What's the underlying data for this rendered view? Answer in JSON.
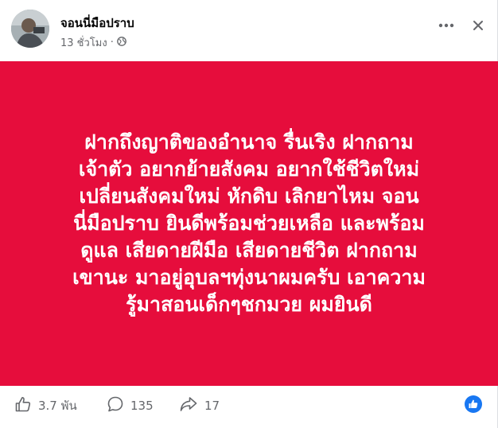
{
  "post": {
    "author": "จอนนี่มือปราบ",
    "time": "13 ชั่วโมง",
    "separator": "·",
    "privacy_icon": "globe-icon",
    "text": "ฝากถึงญาติของอำนาจ รื่นเริง ฝากถาม\nเจ้าตัว อยากย้ายสังคม อยากใช้ชีวิตใหม่\nเปลี่ยนสังคมใหม่ หักดิบ เลิกยาไหม จอน\nนี่มือปราบ ยินดีพร้อมช่วยเหลือ และพร้อม\nดูแล เสียดายฝีมือ เสียดายชีวิต ฝากถาม\nเขานะ มาอยู่อุบลฯทุ่งนาผมครับ เอาความ\nรู้มาสอนเด็กๆชกมวย ผมยินดี",
    "background_color": "#e60d3c"
  },
  "stats": {
    "likes": "3.7 พัน",
    "comments": "135",
    "shares": "17"
  },
  "colors": {
    "accent": "#1877f2",
    "muted": "#65676b"
  }
}
